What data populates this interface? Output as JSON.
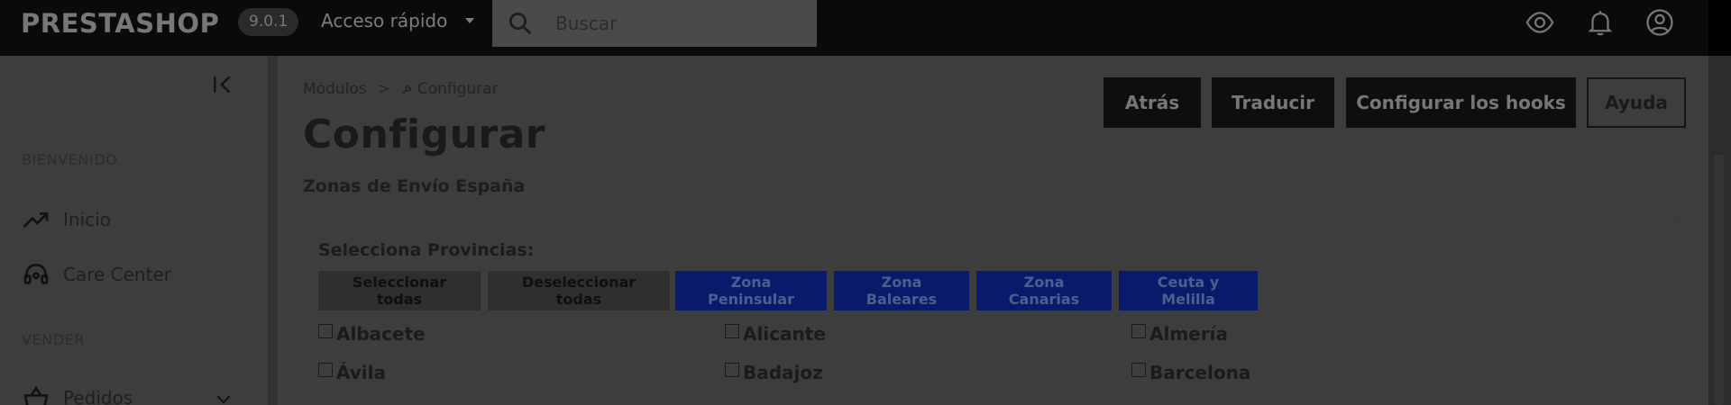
{
  "topbar": {
    "logo": "PRESTASHOP",
    "version": "9.0.1",
    "quick_access": "Acceso rápido",
    "search_placeholder": "Buscar"
  },
  "sidebar": {
    "sections": [
      {
        "label": "BIENVENIDO"
      },
      {
        "label": "VENDER"
      }
    ],
    "items": [
      {
        "label": "Inicio"
      },
      {
        "label": "Care Center"
      },
      {
        "label": "Pedidos"
      }
    ]
  },
  "main": {
    "breadcrumb": {
      "parent": "Módulos",
      "separator": ">",
      "current": "Configurar"
    },
    "title": "Configurar",
    "subtitle": "Zonas de Envío España",
    "header_buttons": [
      {
        "label": "Atrás"
      },
      {
        "label": "Traducir"
      },
      {
        "label": "Configurar los hooks"
      },
      {
        "label": "Ayuda"
      }
    ],
    "panel": {
      "label": "Selecciona Provincias:",
      "buttons": [
        {
          "label": "Seleccionar todas"
        },
        {
          "label": "Deseleccionar todas"
        },
        {
          "label": "Zona Peninsular"
        },
        {
          "label": "Zona Baleares"
        },
        {
          "label": "Zona Canarias"
        },
        {
          "label": "Ceuta y Melilla"
        }
      ],
      "provinces": [
        {
          "label": "Albacete",
          "checked": false
        },
        {
          "label": "Alicante",
          "checked": false
        },
        {
          "label": "Almería",
          "checked": false
        },
        {
          "label": "Ávila",
          "checked": false
        },
        {
          "label": "Badajoz",
          "checked": false
        },
        {
          "label": "Barcelona",
          "checked": false
        }
      ]
    }
  },
  "colors": {
    "topbar_bg": "#0a0a0a",
    "page_bg": "#3d3d3d",
    "zone_button": "#0a1a6a",
    "neutral_button": "#2f2f2f"
  }
}
